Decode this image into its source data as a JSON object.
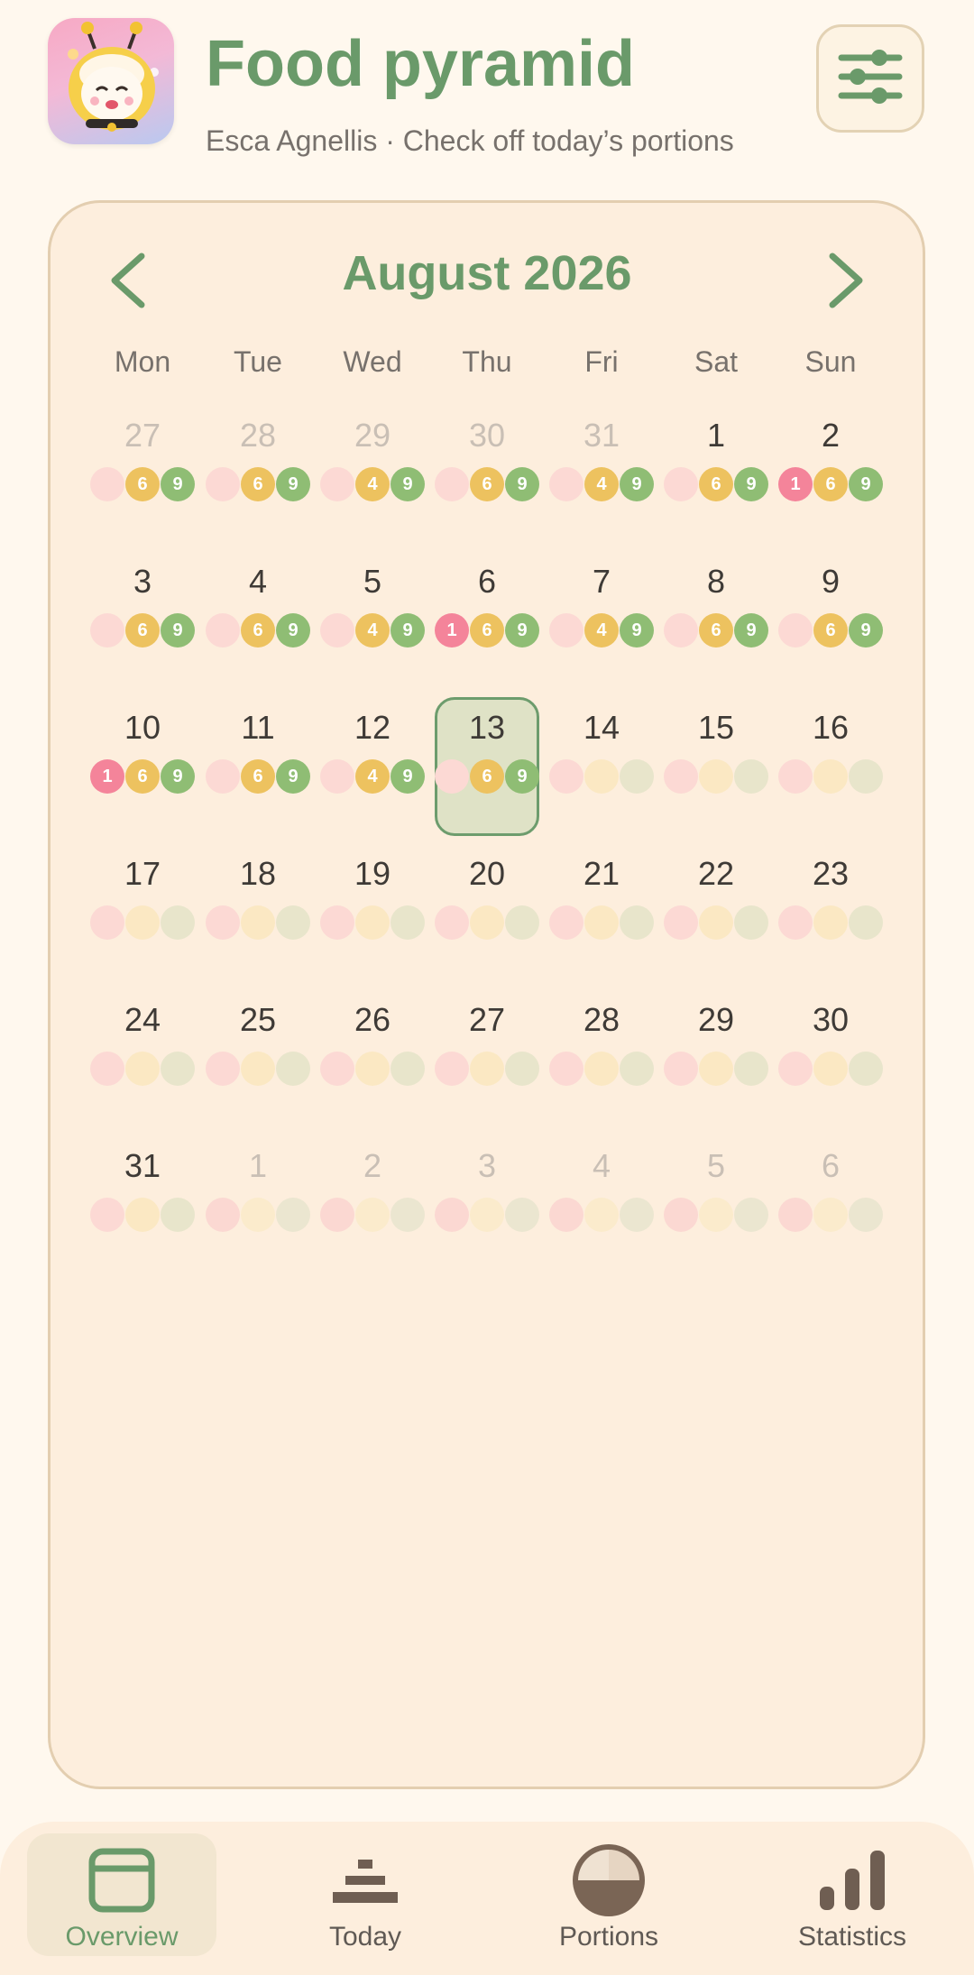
{
  "header": {
    "title": "Food pyramid",
    "subtitle": "Esca Agnellis · Check off today’s portions"
  },
  "calendar": {
    "month_label": "August 2026",
    "weekdays": [
      "Mon",
      "Tue",
      "Wed",
      "Thu",
      "Fri",
      "Sat",
      "Sun"
    ],
    "today": "13",
    "weeks": [
      [
        {
          "day": "27",
          "muted": true,
          "counts": [
            "",
            "6",
            "9"
          ]
        },
        {
          "day": "28",
          "muted": true,
          "counts": [
            "",
            "6",
            "9"
          ]
        },
        {
          "day": "29",
          "muted": true,
          "counts": [
            "",
            "4",
            "9"
          ]
        },
        {
          "day": "30",
          "muted": true,
          "counts": [
            "",
            "6",
            "9"
          ]
        },
        {
          "day": "31",
          "muted": true,
          "counts": [
            "",
            "4",
            "9"
          ]
        },
        {
          "day": "1",
          "muted": false,
          "counts": [
            "",
            "6",
            "9"
          ]
        },
        {
          "day": "2",
          "muted": false,
          "counts": [
            "1",
            "6",
            "9"
          ]
        }
      ],
      [
        {
          "day": "3",
          "muted": false,
          "counts": [
            "",
            "6",
            "9"
          ]
        },
        {
          "day": "4",
          "muted": false,
          "counts": [
            "",
            "6",
            "9"
          ]
        },
        {
          "day": "5",
          "muted": false,
          "counts": [
            "",
            "4",
            "9"
          ]
        },
        {
          "day": "6",
          "muted": false,
          "counts": [
            "1",
            "6",
            "9"
          ]
        },
        {
          "day": "7",
          "muted": false,
          "counts": [
            "",
            "4",
            "9"
          ]
        },
        {
          "day": "8",
          "muted": false,
          "counts": [
            "",
            "6",
            "9"
          ]
        },
        {
          "day": "9",
          "muted": false,
          "counts": [
            "",
            "6",
            "9"
          ]
        }
      ],
      [
        {
          "day": "10",
          "muted": false,
          "counts": [
            "1",
            "6",
            "9"
          ]
        },
        {
          "day": "11",
          "muted": false,
          "counts": [
            "",
            "6",
            "9"
          ]
        },
        {
          "day": "12",
          "muted": false,
          "counts": [
            "",
            "4",
            "9"
          ]
        },
        {
          "day": "13",
          "muted": false,
          "counts": [
            "",
            "6",
            "9"
          ]
        },
        {
          "day": "14",
          "muted": false,
          "counts": [
            "",
            "",
            ""
          ]
        },
        {
          "day": "15",
          "muted": false,
          "counts": [
            "",
            "",
            ""
          ]
        },
        {
          "day": "16",
          "muted": false,
          "counts": [
            "",
            "",
            ""
          ]
        }
      ],
      [
        {
          "day": "17",
          "muted": false,
          "counts": [
            "",
            "",
            ""
          ]
        },
        {
          "day": "18",
          "muted": false,
          "counts": [
            "",
            "",
            ""
          ]
        },
        {
          "day": "19",
          "muted": false,
          "counts": [
            "",
            "",
            ""
          ]
        },
        {
          "day": "20",
          "muted": false,
          "counts": [
            "",
            "",
            ""
          ]
        },
        {
          "day": "21",
          "muted": false,
          "counts": [
            "",
            "",
            ""
          ]
        },
        {
          "day": "22",
          "muted": false,
          "counts": [
            "",
            "",
            ""
          ]
        },
        {
          "day": "23",
          "muted": false,
          "counts": [
            "",
            "",
            ""
          ]
        }
      ],
      [
        {
          "day": "24",
          "muted": false,
          "counts": [
            "",
            "",
            ""
          ]
        },
        {
          "day": "25",
          "muted": false,
          "counts": [
            "",
            "",
            ""
          ]
        },
        {
          "day": "26",
          "muted": false,
          "counts": [
            "",
            "",
            ""
          ]
        },
        {
          "day": "27",
          "muted": false,
          "counts": [
            "",
            "",
            ""
          ]
        },
        {
          "day": "28",
          "muted": false,
          "counts": [
            "",
            "",
            ""
          ]
        },
        {
          "day": "29",
          "muted": false,
          "counts": [
            "",
            "",
            ""
          ]
        },
        {
          "day": "30",
          "muted": false,
          "counts": [
            "",
            "",
            ""
          ]
        }
      ],
      [
        {
          "day": "31",
          "muted": false,
          "counts": [
            "",
            "",
            ""
          ]
        },
        {
          "day": "1",
          "muted": true,
          "counts": [
            "",
            "",
            ""
          ]
        },
        {
          "day": "2",
          "muted": true,
          "counts": [
            "",
            "",
            ""
          ]
        },
        {
          "day": "3",
          "muted": true,
          "counts": [
            "",
            "",
            ""
          ]
        },
        {
          "day": "4",
          "muted": true,
          "counts": [
            "",
            "",
            ""
          ]
        },
        {
          "day": "5",
          "muted": true,
          "counts": [
            "",
            "",
            ""
          ]
        },
        {
          "day": "6",
          "muted": true,
          "counts": [
            "",
            "",
            ""
          ]
        }
      ]
    ]
  },
  "bottom_nav": {
    "items": [
      {
        "label": "Overview",
        "icon": "calendar-icon",
        "active": true
      },
      {
        "label": "Today",
        "icon": "pyramid-icon",
        "active": false
      },
      {
        "label": "Portions",
        "icon": "pie-chart-icon",
        "active": false
      },
      {
        "label": "Statistics",
        "icon": "bar-chart-icon",
        "active": false
      }
    ]
  },
  "colors": {
    "accent_green": "#6a9a6a",
    "portion_pink": "#f4849a",
    "portion_yellow": "#edc25f",
    "portion_green": "#8fbd74",
    "background": "#fff8ee",
    "card": "#fdeedd"
  }
}
